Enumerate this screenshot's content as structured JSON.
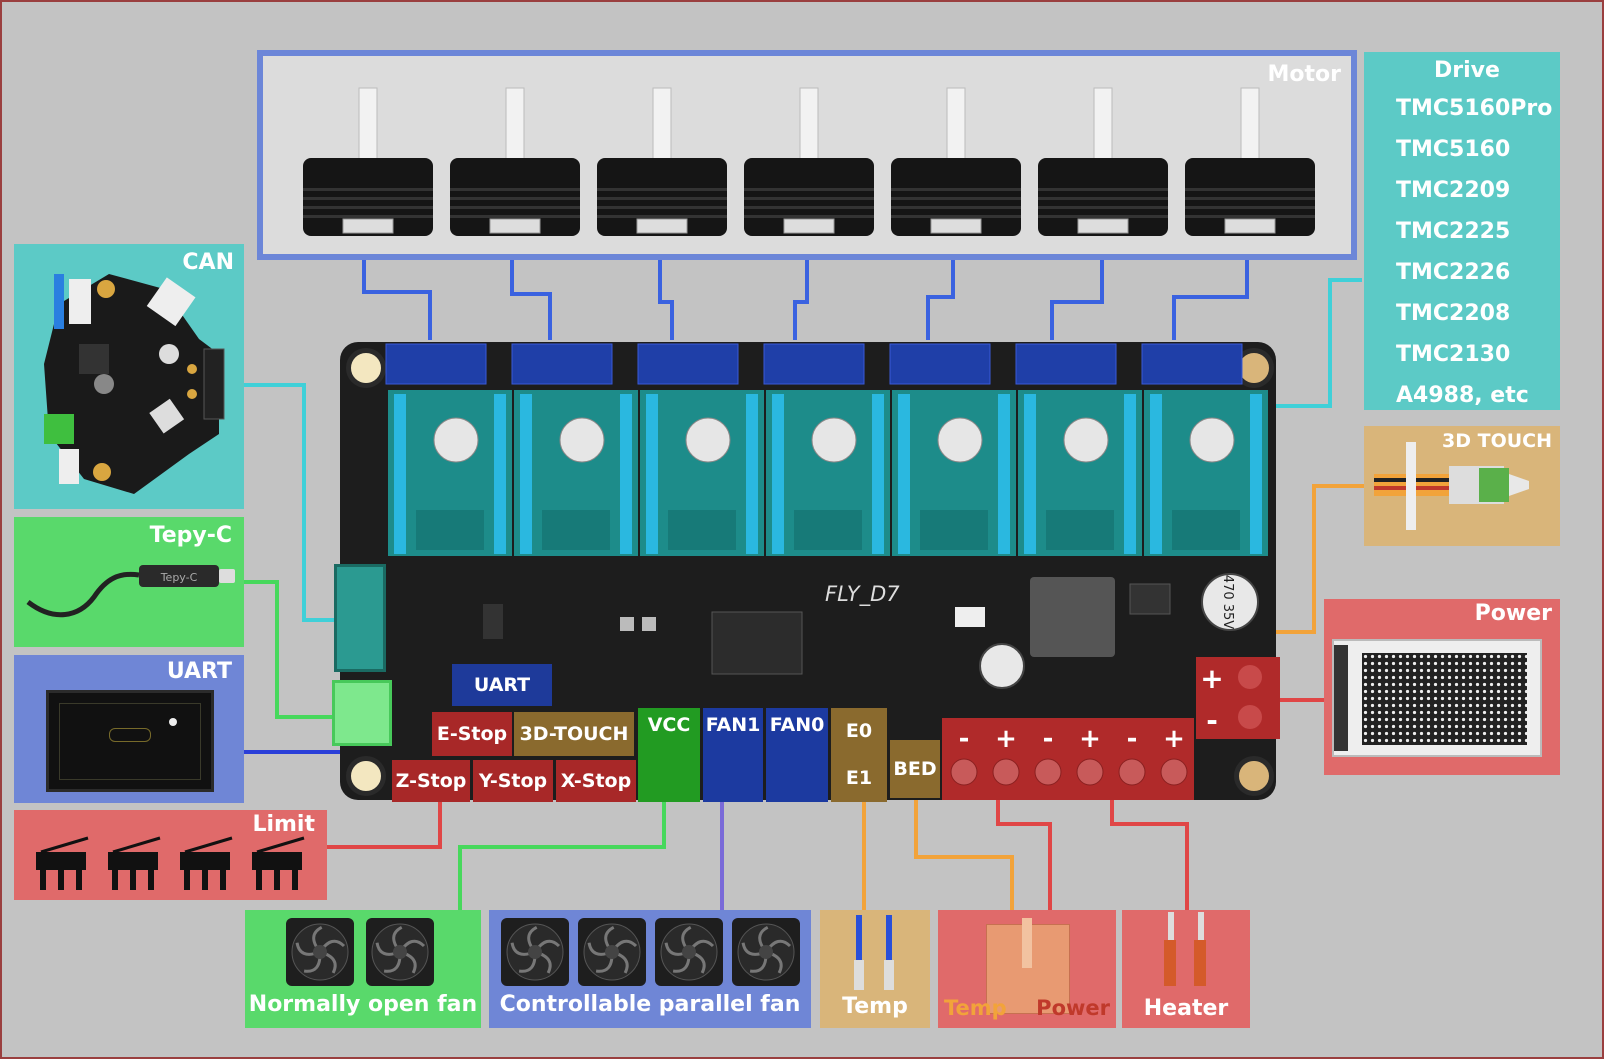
{
  "panels": {
    "motor": "Motor",
    "can": "CAN",
    "tepyc": "Tepy-C",
    "uart": "UART",
    "limit": "Limit",
    "touch": "3D TOUCH",
    "power": "Power"
  },
  "drive": {
    "title": "Drive",
    "items": [
      "TMC5160Pro",
      "TMC5160",
      "TMC2209",
      "TMC2225",
      "TMC2226",
      "TMC2208",
      "TMC2130",
      "A4988, etc"
    ]
  },
  "board": {
    "name": "FLY_D7",
    "cable_label": "Tepy-C",
    "labels": {
      "uart": "UART",
      "estop": "E-Stop",
      "touch": "3D-TOUCH",
      "vcc": "VCC",
      "fan1": "FAN1",
      "fan0": "FAN0",
      "e0": "E0",
      "e1": "E1",
      "bed": "BED",
      "zstop": "Z-Stop",
      "ystop": "Y-Stop",
      "xstop": "X-Stop"
    }
  },
  "bottom": {
    "normally_open_fan": "Normally open fan",
    "parallel_fan": "Controllable parallel fan",
    "temp": "Temp",
    "bed_temp": "Temp",
    "bed_power": "Power",
    "heater": "Heater"
  },
  "colors": {
    "motor_border": "#6c86d8",
    "drive_bg": "#5ccac6",
    "can_bg": "#5ccac6",
    "tepyc_bg": "#59d96b",
    "uart_bg": "#6f86d6",
    "limit_bg": "#e06a6a",
    "touch_bg": "#d9b57a",
    "power_bg": "#e06a6a"
  }
}
